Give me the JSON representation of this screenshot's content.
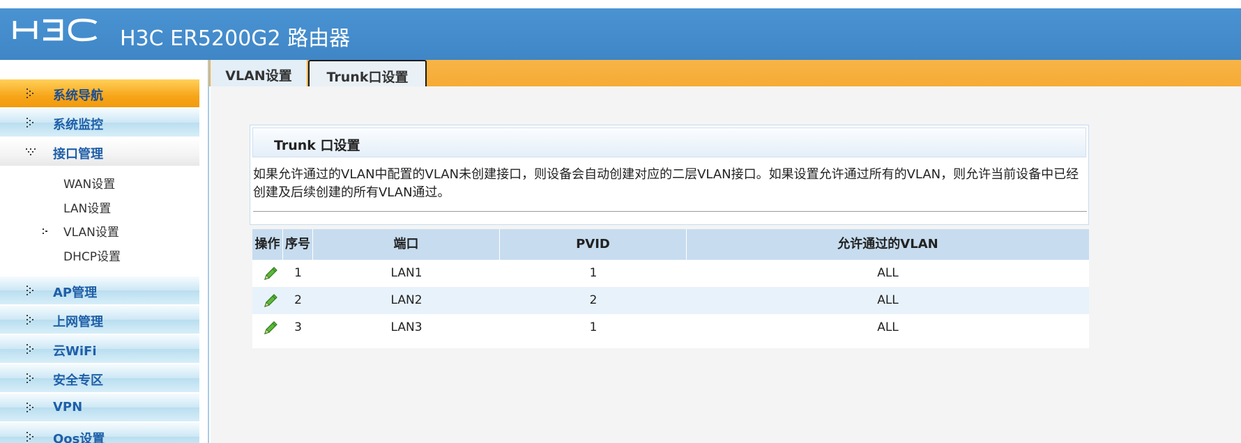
{
  "header": {
    "logo_text": "H3C",
    "title": "H3C ER5200G2 路由器",
    "brand_color": "#3f86c6"
  },
  "sidebar": {
    "items": [
      {
        "label": "系统导航",
        "state": "active"
      },
      {
        "label": "系统监控",
        "state": "normal"
      },
      {
        "label": "接口管理",
        "state": "open"
      },
      {
        "label": "AP管理",
        "state": "normal"
      },
      {
        "label": "上网管理",
        "state": "normal"
      },
      {
        "label": "云WiFi",
        "state": "normal"
      },
      {
        "label": "安全专区",
        "state": "normal"
      },
      {
        "label": "VPN",
        "state": "normal"
      },
      {
        "label": "Qos设置",
        "state": "normal"
      }
    ],
    "subitems": [
      {
        "label": "WAN设置",
        "selected": false
      },
      {
        "label": "LAN设置",
        "selected": false
      },
      {
        "label": "VLAN设置",
        "selected": true
      },
      {
        "label": "DHCP设置",
        "selected": false
      }
    ]
  },
  "tabs": [
    {
      "label": "VLAN设置",
      "active": false
    },
    {
      "label": "Trunk口设置",
      "active": true
    }
  ],
  "panel": {
    "title": "Trunk 口设置",
    "description": "如果允许通过的VLAN中配置的VLAN未创建接口，则设备会自动创建对应的二层VLAN接口。如果设置允许通过所有的VLAN，则允许当前设备中已经创建及后续创建的所有VLAN通过。"
  },
  "table": {
    "columns": [
      "操作",
      "序号",
      "端口",
      "PVID",
      "允许通过的VLAN"
    ],
    "rows": [
      {
        "index": "1",
        "port": "LAN1",
        "pvid": "1",
        "vlans": "ALL"
      },
      {
        "index": "2",
        "port": "LAN2",
        "pvid": "2",
        "vlans": "ALL"
      },
      {
        "index": "3",
        "port": "LAN3",
        "pvid": "1",
        "vlans": "ALL"
      }
    ],
    "action_icon": "edit-pencil-icon"
  },
  "colors": {
    "tabbar": "#f6ab34",
    "active_menu": "#f29a0c",
    "table_header": "#c7dcef",
    "row_alt": "#e8f2fb"
  }
}
